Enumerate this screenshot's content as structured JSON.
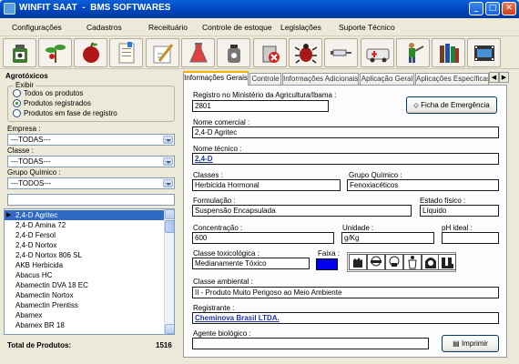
{
  "window": {
    "title": "WINFIT SAAT  -  BMS SOFTWARES",
    "buttons": {
      "minimize": "_",
      "maximize": "□",
      "close": "✕"
    }
  },
  "menu": [
    "Configurações",
    "Cadastros",
    "Receituário",
    "Controle de estoque",
    "Legislações",
    "Suporte Técnico"
  ],
  "toolbar": {
    "icons": [
      "agrochemical-bottle-icon",
      "plant-seedling-icon",
      "apple-icon",
      "notepad-icon",
      "pen-document-icon",
      "flask-icon",
      "sprayer-icon",
      "pesticide-can-icon",
      "bug-icon",
      "syringe-icon",
      "ambulance-icon",
      "person-sprayer-icon",
      "books-icon",
      "film-icon"
    ],
    "colors": {
      "bottle": "#3b7a2e",
      "leaf": "#3b9a2c",
      "apple": "#b01818",
      "bug": "#a61a1a",
      "flask": "#e04040",
      "ambulance": "#e8e8e8",
      "books": "#704020"
    }
  },
  "left": {
    "title": "Agrotóxicos",
    "filter_group": {
      "legend": "Exibir",
      "options": [
        "Todos os produtos",
        "Produtos registrados",
        "Produtos em fase de registro"
      ],
      "selected_index": 1
    },
    "empresa_label": "Empresa :",
    "empresa_value": "---TODAS---",
    "classe_label": "Classe :",
    "classe_value": "---TODAS---",
    "grupo_label": "Grupo Químico :",
    "grupo_value": "---TODOS---",
    "search_value": "",
    "products": [
      "2,4-D Agritec",
      "2,4-D Amina 72",
      "2,4-D Fersol",
      "2,4-D Nortox",
      "2,4-D Nortox 806 SL",
      "AKB Herbicida",
      "Abacus HC",
      "Abamectin DVA 18 EC",
      "Abamectin Nortox",
      "Abamectin Prentiss",
      "Abamex",
      "Abamex BR 18"
    ],
    "selected_product_index": 0,
    "total_label": "Total de Produtos:",
    "total_value": "1516"
  },
  "tabs": [
    "Informações Gerais",
    "Controle",
    "Informações Adicionais",
    "Aplicação Geral",
    "Aplicações Específicas"
  ],
  "active_tab": 0,
  "form": {
    "registro_label": "Registro no Ministério da Agricultura/Ibama :",
    "registro_value": "2801",
    "ficha_button": "Ficha de Emergência",
    "nome_comercial_label": "Nome comercial :",
    "nome_comercial_value": "2,4-D Agritec",
    "nome_tecnico_label": "Nome técnico :",
    "nome_tecnico_value": "2,4-D",
    "classes_label": "Classes :",
    "classes_value": "Herbicida Hormonal",
    "grupo_quimico_label": "Grupo Químico :",
    "grupo_quimico_value": "Fenoxiacéticos",
    "formulacao_label": "Formulação :",
    "formulacao_value": "Suspensão Encapsulada",
    "estado_fisico_label": "Estado físico :",
    "estado_fisico_value": "Líquido",
    "concentracao_label": "Concentração :",
    "concentracao_value": "600",
    "unidade_label": "Unidade :",
    "unidade_value": "g/Kg",
    "ph_label": "pH ideal :",
    "ph_value": "",
    "classe_tox_label": "Classe toxicológica :",
    "classe_tox_value": "Medianamente Tóxico",
    "faixa_label": "Faixa :",
    "faixa_color": "#0000ee",
    "hazard_icons": [
      "gloves-icon",
      "goggles-icon",
      "mask-icon",
      "protective-suit-icon",
      "hood-icon",
      "boots-icon"
    ],
    "classe_ambiental_label": "Classe ambiental :",
    "classe_ambiental_value": "II - Produto Muito Perigoso ao Meio Ambiente",
    "registrante_label": "Registrante :",
    "registrante_value": "Cheminova Brasil LTDA.",
    "agente_label": "Agente biológico :",
    "agente_value": "",
    "imprimir_button": "Imprimir"
  }
}
